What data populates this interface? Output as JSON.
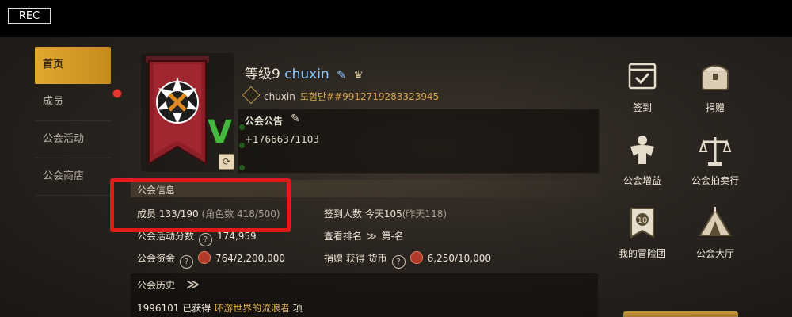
{
  "recording": {
    "label": "REC"
  },
  "sidebar": {
    "items": [
      {
        "label": "首页"
      },
      {
        "label": "成员"
      },
      {
        "label": "公会活动"
      },
      {
        "label": "公会商店"
      }
    ]
  },
  "guild": {
    "level": "等级9",
    "name": "chuxin",
    "owner": "chuxin",
    "guild_id": "모험단##9912719283323945",
    "emblem_rank": "V"
  },
  "notice": {
    "title": "公会公告",
    "text": "+17666371103"
  },
  "info": {
    "title": "公会信息",
    "members_label": "成员",
    "members_value": "133/190",
    "members_roles": "(角色数 418/500)",
    "checkin_label": "签到人数",
    "checkin_today": "今天105",
    "checkin_yesterday": "(昨天118)",
    "activity_label": "公会活动分数",
    "activity_value": "174,959",
    "ranking_label": "查看排名",
    "ranking_value": "第-名",
    "funds_label": "公会资金",
    "funds_value": "764/2,200,000",
    "donate_label": "捐赠 获得 货币",
    "donate_value": "6,250/10,000"
  },
  "history": {
    "title": "公会历史",
    "entry_prefix": "1996101 已获得",
    "entry_highlight": "环游世界的流浪者",
    "entry_suffix": "项"
  },
  "actions": [
    {
      "label": "签到",
      "icon": "calendar-check-icon"
    },
    {
      "label": "捐赠",
      "icon": "treasure-chest-icon"
    },
    {
      "label": "公会增益",
      "icon": "strongman-icon"
    },
    {
      "label": "公会拍卖行",
      "icon": "scales-icon"
    },
    {
      "label": "我的冒险团",
      "icon": "banner-10-icon"
    },
    {
      "label": "公会大厅",
      "icon": "tent-icon"
    }
  ],
  "colors": {
    "accent": "#e0a92e",
    "highlight_box": "#e11a1a",
    "name": "#8cc6ff",
    "badge_green": "#46b83f"
  }
}
